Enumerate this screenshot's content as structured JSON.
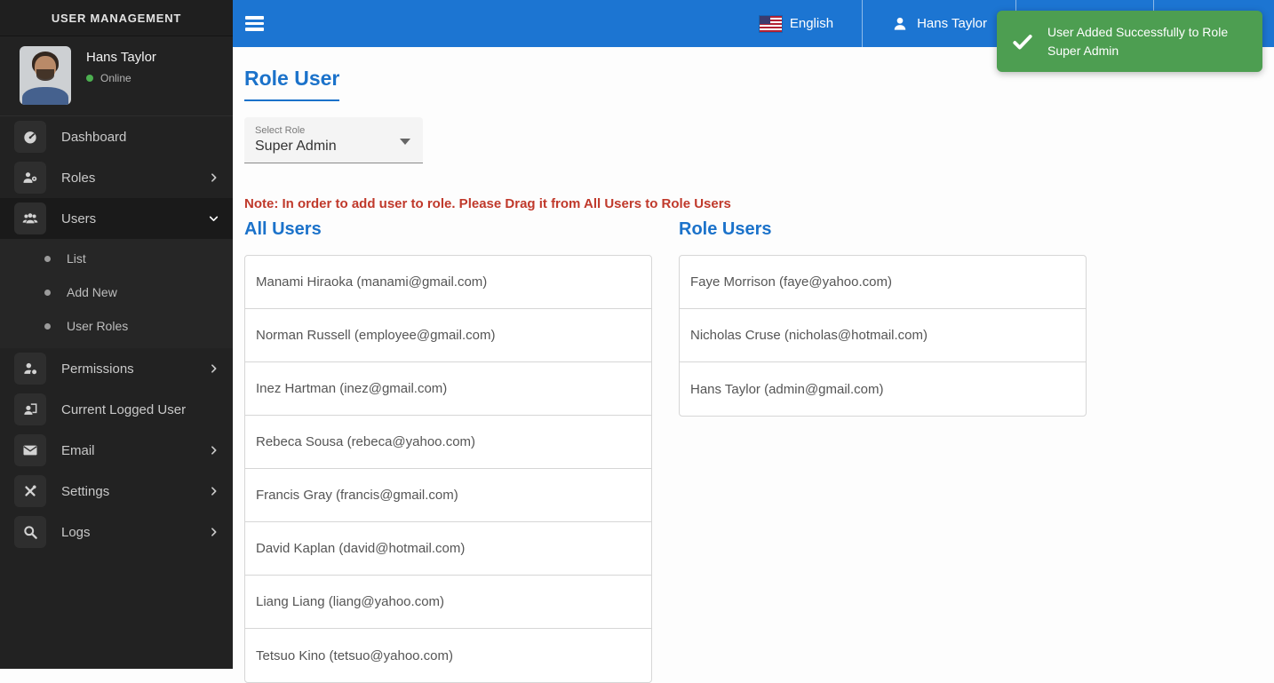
{
  "sidebar": {
    "title": "USER MANAGEMENT",
    "profile": {
      "name": "Hans Taylor",
      "status": "Online"
    },
    "menu": [
      {
        "label": "Dashboard",
        "icon": "dashboard-icon"
      },
      {
        "label": "Roles",
        "icon": "roles-icon"
      },
      {
        "label": "Users",
        "icon": "users-icon"
      },
      {
        "label": "Permissions",
        "icon": "permissions-icon"
      },
      {
        "label": "Current Logged User",
        "icon": "logged-user-icon"
      },
      {
        "label": "Email",
        "icon": "email-icon"
      },
      {
        "label": "Settings",
        "icon": "settings-icon"
      },
      {
        "label": "Logs",
        "icon": "logs-icon"
      }
    ],
    "users_submenu": [
      "List",
      "Add New",
      "User Roles"
    ]
  },
  "topbar": {
    "language": "English",
    "language_icon": "us-flag-icon",
    "user": "Hans Taylor",
    "menu_icon": "hamburger-icon"
  },
  "toast": {
    "message": "User Added Successfully to Role Super Admin",
    "icon": "check-icon"
  },
  "main": {
    "title": "Role User",
    "select_role": {
      "label": "Select Role",
      "value": "Super Admin"
    },
    "note": "Note: In order to add user to role. Please Drag it from All Users to Role Users",
    "all_users": {
      "title": "All Users",
      "items": [
        "Manami Hiraoka (manami@gmail.com)",
        "Norman Russell (employee@gmail.com)",
        "Inez Hartman (inez@gmail.com)",
        "Rebeca Sousa (rebeca@yahoo.com)",
        "Francis Gray (francis@gmail.com)",
        "David Kaplan (david@hotmail.com)",
        "Liang Liang (liang@yahoo.com)",
        "Tetsuo Kino (tetsuo@yahoo.com)"
      ]
    },
    "role_users": {
      "title": "Role Users",
      "items": [
        "Faye Morrison (faye@yahoo.com)",
        "Nicholas Cruse (nicholas@hotmail.com)",
        "Hans Taylor (admin@gmail.com)"
      ]
    }
  },
  "colors": {
    "topbar_blue": "#1c75d2",
    "accent_blue": "#1b72ca",
    "toast_green": "#4d9e51",
    "note_red": "#c0392b",
    "online_green": "#4caf50",
    "sidebar_bg": "#222222"
  }
}
